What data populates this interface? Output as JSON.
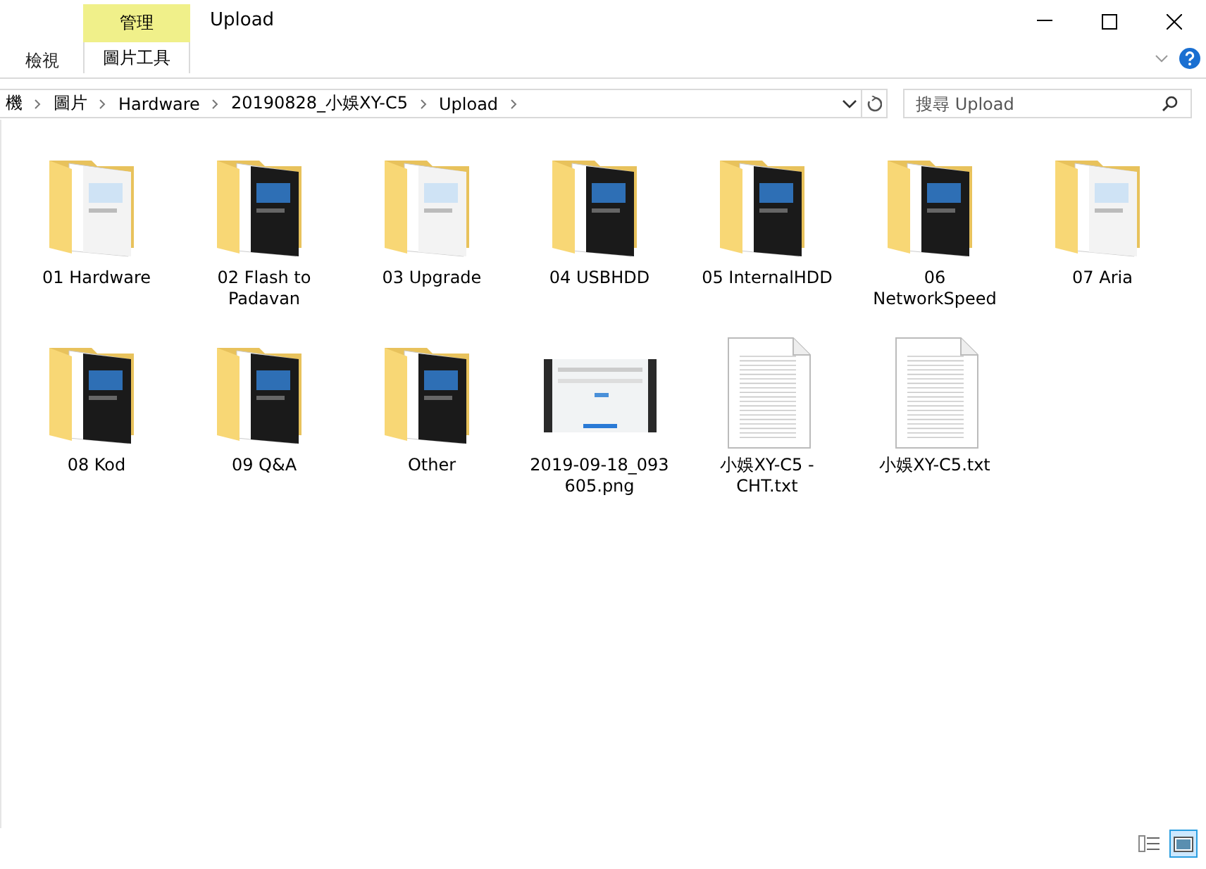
{
  "window": {
    "title": "Upload"
  },
  "ribbon": {
    "tabs": [
      {
        "label": "檢視"
      }
    ],
    "context_group": {
      "label": "管理",
      "tab": {
        "label": "圖片工具"
      }
    }
  },
  "address_bar": {
    "breadcrumbs": [
      "機",
      "圖片",
      "Hardware",
      "20190828_小娛XY-C5",
      "Upload"
    ]
  },
  "search": {
    "placeholder": "搜尋 Upload"
  },
  "items": [
    {
      "kind": "folder",
      "name": "01 Hardware",
      "selected": false
    },
    {
      "kind": "folder",
      "name": "02 Flash to Padavan",
      "selected": false
    },
    {
      "kind": "folder",
      "name": "03 Upgrade",
      "selected": false
    },
    {
      "kind": "folder",
      "name": "04 USBHDD",
      "selected": false
    },
    {
      "kind": "folder",
      "name": "05 InternalHDD",
      "selected": false
    },
    {
      "kind": "folder",
      "name": "06 NetworkSpeed",
      "selected": false
    },
    {
      "kind": "folder",
      "name": "07 Aria",
      "selected": false
    },
    {
      "kind": "folder",
      "name": "08 Kod",
      "selected": false
    },
    {
      "kind": "folder",
      "name": "09 Q&A",
      "selected": false
    },
    {
      "kind": "folder",
      "name": "Other",
      "selected": false
    },
    {
      "kind": "image",
      "name": "2019-09-18_093605.png",
      "selected": false
    },
    {
      "kind": "text",
      "name": "小娛XY-C5 - CHT.txt",
      "selected": false
    },
    {
      "kind": "text",
      "name": "小娛XY-C5.txt",
      "selected": false
    }
  ],
  "view_buttons": [
    {
      "kind": "details",
      "selected": false
    },
    {
      "kind": "large_icons",
      "selected": true
    }
  ]
}
